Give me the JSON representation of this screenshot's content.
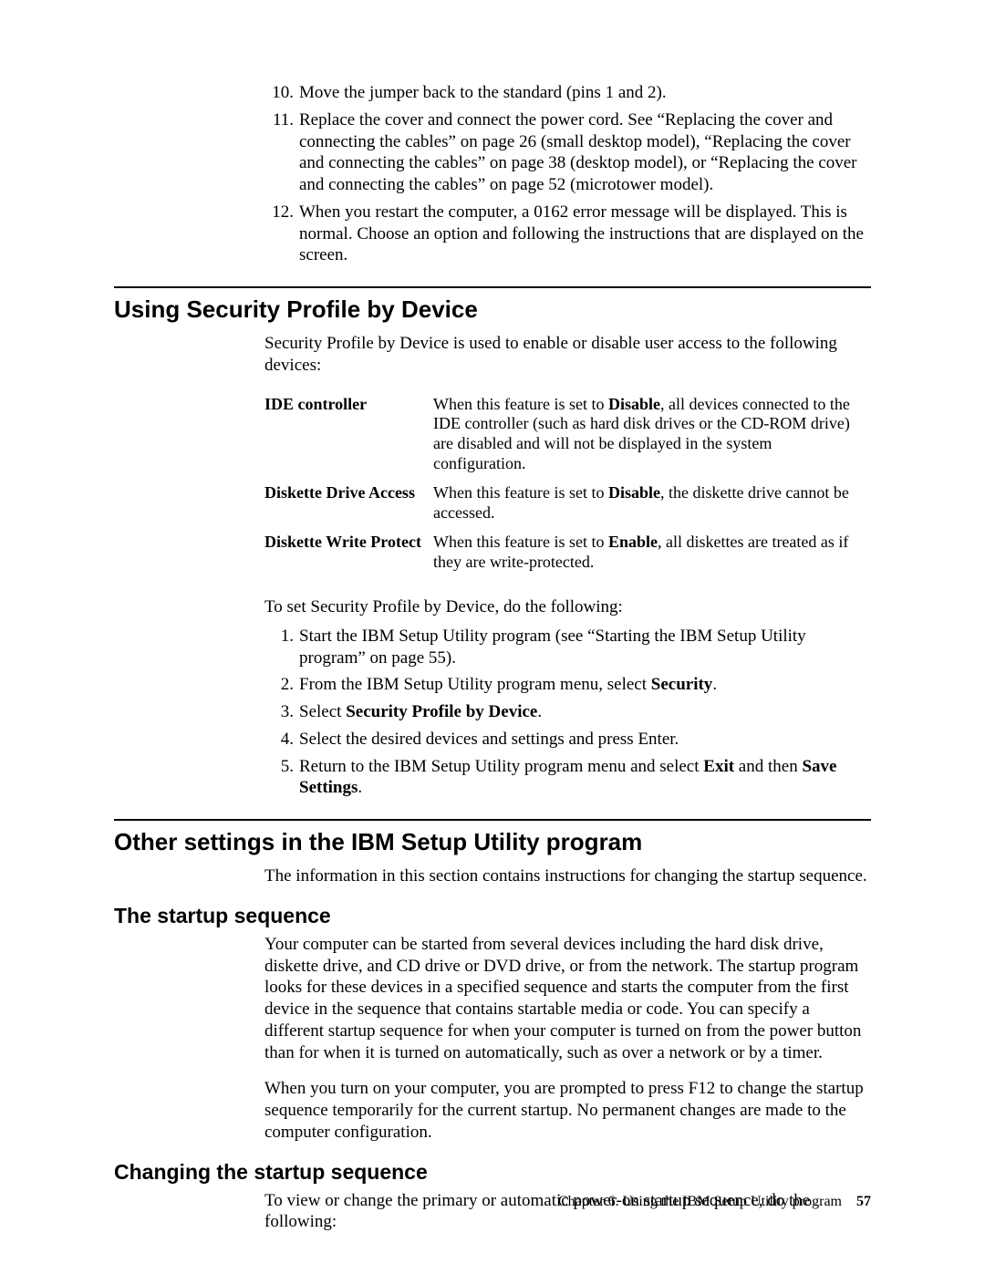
{
  "top_list": [
    {
      "n": "10.",
      "text": "Move the jumper back to the standard (pins 1 and 2)."
    },
    {
      "n": "11.",
      "text": "Replace the cover and connect the power cord. See “Replacing the cover and connecting the cables” on page 26 (small desktop model), “Replacing the cover and connecting the cables” on page 38 (desktop model), or “Replacing the cover and connecting the cables” on page 52 (microtower model)."
    },
    {
      "n": "12.",
      "text": "When you restart the computer, a 0162 error message will be displayed. This is normal. Choose an option and following the instructions that are displayed on the screen."
    }
  ],
  "sec1": {
    "title": "Using Security Profile by Device",
    "intro": "Security Profile by Device is used to enable or disable user access to the following devices:",
    "rows": [
      {
        "term": "IDE controller",
        "pre": "When this feature is set to ",
        "bold": "Disable",
        "post": ", all devices connected to the IDE controller (such as hard disk drives or the CD-ROM drive) are disabled and will not be displayed in the system configuration."
      },
      {
        "term": "Diskette Drive Access",
        "pre": "When this feature is set to ",
        "bold": "Disable",
        "post": ", the diskette drive cannot be accessed."
      },
      {
        "term": "Diskette Write Protect",
        "pre": "When this feature is set to ",
        "bold": "Enable",
        "post": ", all diskettes are treated as if they are write-protected."
      }
    ],
    "after": "To set Security Profile by Device, do the following:",
    "steps": [
      {
        "n": "1.",
        "html": "Start the IBM Setup Utility program (see “Starting the IBM Setup Utility program” on page 55)."
      },
      {
        "n": "2.",
        "html": "From the IBM Setup Utility program menu, select <b>Security</b>."
      },
      {
        "n": "3.",
        "html": "Select <b>Security Profile by Device</b>."
      },
      {
        "n": "4.",
        "html": "Select the desired devices and settings and press Enter."
      },
      {
        "n": "5.",
        "html": "Return to the IBM Setup Utility program menu and select <b>Exit</b> and then <b>Save Settings</b>."
      }
    ]
  },
  "sec2": {
    "title": "Other settings in the IBM Setup Utility program",
    "intro": "The information in this section contains instructions for changing the startup sequence.",
    "sub1_title": "The startup sequence",
    "sub1_p1": "Your computer can be started from several devices including the hard disk drive, diskette drive, and CD drive or DVD drive, or from the network. The startup program looks for these devices in a specified sequence and starts the computer from the first device in the sequence that contains startable media or code. You can specify a different startup sequence for when your computer is turned on from the power button than for when it is turned on automatically, such as over a network or by a timer.",
    "sub1_p2": "When you turn on your computer, you are prompted to press F12 to change the startup sequence temporarily for the current startup. No permanent changes are made to the computer configuration.",
    "sub2_title": "Changing the startup sequence",
    "sub2_p": "To view or change the primary or automatic power-on startup sequence, do the following:"
  },
  "footer": {
    "chapter": "Chapter 6. Using the IBM Setup Utility program",
    "page": "57"
  }
}
